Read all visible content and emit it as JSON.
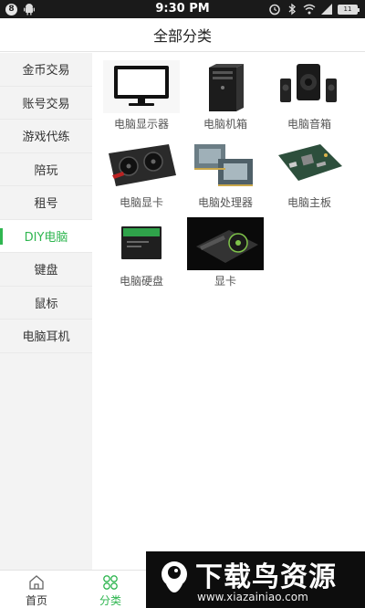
{
  "status_bar": {
    "badge": "8",
    "time": "9:30 PM",
    "battery": "11"
  },
  "header": {
    "title": "全部分类"
  },
  "sidebar": {
    "items": [
      {
        "label": "金币交易"
      },
      {
        "label": "账号交易"
      },
      {
        "label": "游戏代练"
      },
      {
        "label": "陪玩"
      },
      {
        "label": "租号"
      },
      {
        "label": "DIY电脑",
        "active": true
      },
      {
        "label": "键盘"
      },
      {
        "label": "鼠标"
      },
      {
        "label": "电脑耳机"
      }
    ]
  },
  "categories": [
    {
      "label": "电脑显示器",
      "icon": "monitor-icon"
    },
    {
      "label": "电脑机箱",
      "icon": "pc-case-icon"
    },
    {
      "label": "电脑音箱",
      "icon": "speakers-icon"
    },
    {
      "label": "电脑显卡",
      "icon": "graphics-card-icon"
    },
    {
      "label": "电脑处理器",
      "icon": "cpu-icon"
    },
    {
      "label": "电脑主板",
      "icon": "motherboard-icon"
    },
    {
      "label": "电脑硬盘",
      "icon": "ssd-icon"
    },
    {
      "label": "显卡",
      "icon": "gpu-icon"
    }
  ],
  "bottom_nav": {
    "home": {
      "label": "首页",
      "icon": "home-icon"
    },
    "category": {
      "label": "分类",
      "icon": "grid-icon",
      "active": true
    }
  },
  "watermark": {
    "title": "下载鸟资源",
    "url": "www.xiazainiao.com"
  },
  "colors": {
    "accent": "#2fb650",
    "status_bar": "#1a1a1a",
    "sidebar_bg": "#f3f3f3"
  }
}
